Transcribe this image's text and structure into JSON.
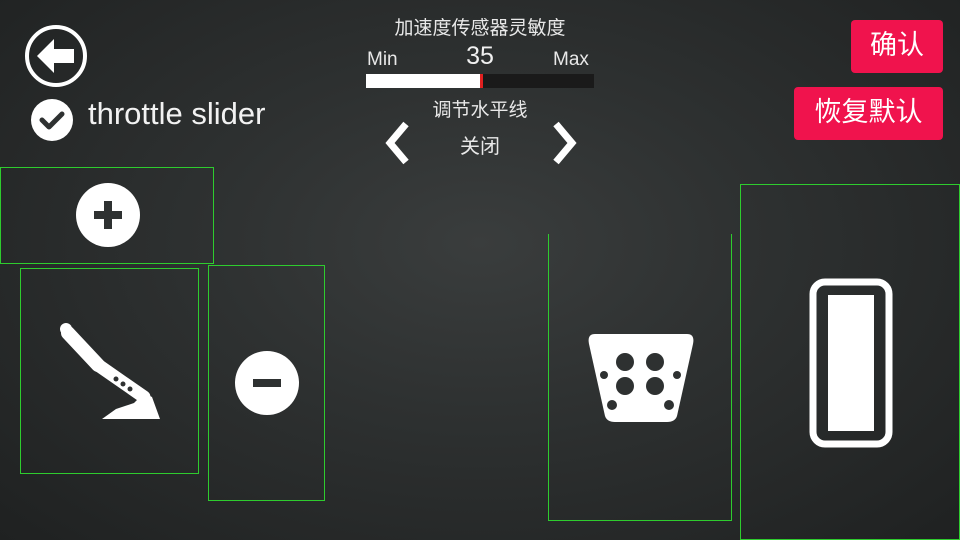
{
  "header": {
    "back_icon": "arrow-left-icon",
    "check_icon": "checkmark-icon",
    "throttle_label": "throttle slider"
  },
  "sensitivity": {
    "title": "加速度传感器灵敏度",
    "min_label": "Min",
    "max_label": "Max",
    "value": "35",
    "fraction": 0.5
  },
  "level": {
    "title": "调节水平线",
    "value": "关闭",
    "prev_icon": "chevron-left-icon",
    "next_icon": "chevron-right-icon"
  },
  "buttons": {
    "confirm": "确认",
    "reset": "恢复默认"
  },
  "controls": {
    "plus_icon": "plus-icon",
    "minus_icon": "minus-icon",
    "handbrake_icon": "handbrake-lever-icon",
    "brake_pedal_icon": "brake-pedal-icon",
    "throttle_icon": "throttle-pedal-icon"
  },
  "colors": {
    "accent_red": "#f0134d",
    "outline_green": "#2ecc2e",
    "slider_marker": "#e02020"
  }
}
